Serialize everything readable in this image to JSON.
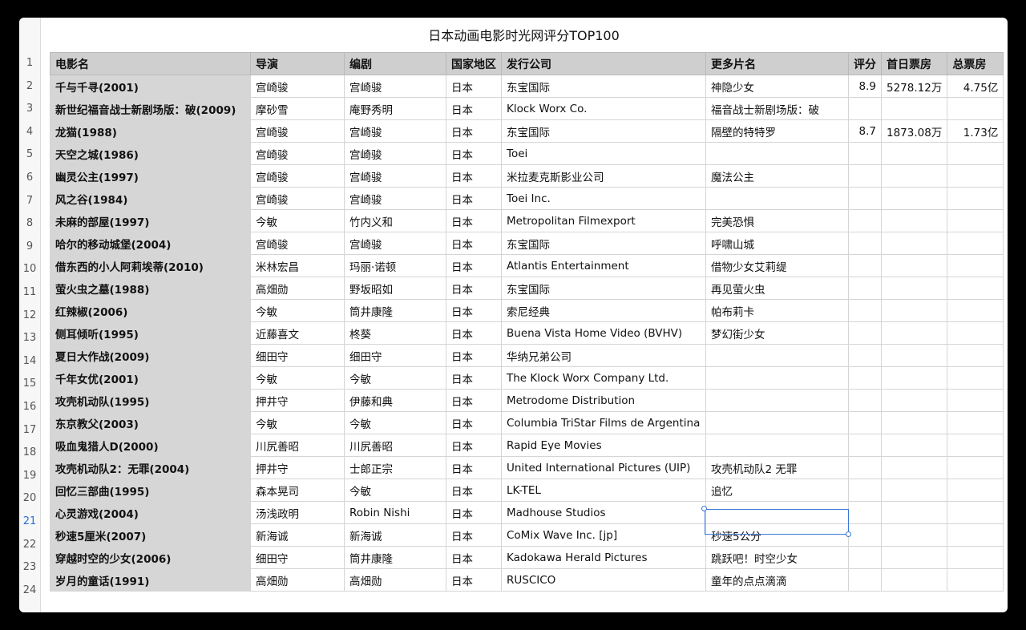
{
  "title": "日本动画电影时光网评分TOP100",
  "headers": [
    "电影名",
    "导演",
    "编剧",
    "国家地区",
    "发行公司",
    "更多片名",
    "评分",
    "首日票房",
    "总票房"
  ],
  "rows": [
    [
      "千与千寻(2001)",
      "宫崎骏",
      "宫崎骏",
      "日本",
      "东宝国际",
      "神隐少女",
      "8.9",
      "5278.12万",
      "4.75亿"
    ],
    [
      "新世纪福音战士新剧场版：破(2009)",
      "摩砂雪",
      "庵野秀明",
      "日本",
      "Klock Worx Co.",
      "福音战士新剧场版：破",
      "",
      "",
      ""
    ],
    [
      "龙猫(1988)",
      "宫崎骏",
      "宫崎骏",
      "日本",
      "东宝国际",
      "隔壁的特特罗",
      "8.7",
      "1873.08万",
      "1.73亿"
    ],
    [
      "天空之城(1986)",
      "宫崎骏",
      "宫崎骏",
      "日本",
      "Toei",
      "",
      "",
      "",
      ""
    ],
    [
      "幽灵公主(1997)",
      "宫崎骏",
      "宫崎骏",
      "日本",
      "米拉麦克斯影业公司",
      "魔法公主",
      "",
      "",
      ""
    ],
    [
      "风之谷(1984)",
      "宫崎骏",
      "宫崎骏",
      "日本",
      "Toei Inc.",
      "",
      "",
      "",
      ""
    ],
    [
      "未麻的部屋(1997)",
      "今敏",
      "竹内义和",
      "日本",
      "Metropolitan Filmexport",
      "完美恐惧",
      "",
      "",
      ""
    ],
    [
      "哈尔的移动城堡(2004)",
      "宫崎骏",
      "宫崎骏",
      "日本",
      "东宝国际",
      "呼啸山城",
      "",
      "",
      ""
    ],
    [
      "借东西的小人阿莉埃蒂(2010)",
      "米林宏昌",
      "玛丽·诺顿",
      "日本",
      "Atlantis Entertainment",
      "借物少女艾莉缇",
      "",
      "",
      ""
    ],
    [
      "萤火虫之墓(1988)",
      "高畑勋",
      "野坂昭如",
      "日本",
      "东宝国际",
      "再见萤火虫",
      "",
      "",
      ""
    ],
    [
      "红辣椒(2006)",
      "今敏",
      "筒井康隆",
      "日本",
      "索尼经典",
      "帕布莉卡",
      "",
      "",
      ""
    ],
    [
      "侧耳倾听(1995)",
      "近藤喜文",
      "柊葵",
      "日本",
      "Buena Vista Home Video (BVHV)",
      "梦幻街少女",
      "",
      "",
      ""
    ],
    [
      "夏日大作战(2009)",
      "细田守",
      "细田守",
      "日本",
      "华纳兄弟公司",
      "",
      "",
      "",
      ""
    ],
    [
      "千年女优(2001)",
      "今敏",
      "今敏",
      "日本",
      "The Klock Worx Company Ltd.",
      "",
      "",
      "",
      ""
    ],
    [
      "攻壳机动队(1995)",
      "押井守",
      "伊藤和典",
      "日本",
      "Metrodome Distribution",
      "",
      "",
      "",
      ""
    ],
    [
      "东京教父(2003)",
      "今敏",
      "今敏",
      "日本",
      "Columbia TriStar Films de Argentina",
      "",
      "",
      "",
      ""
    ],
    [
      "吸血鬼猎人D(2000)",
      "川尻善昭",
      "川尻善昭",
      "日本",
      "Rapid Eye Movies",
      "",
      "",
      "",
      ""
    ],
    [
      "攻壳机动队2：无罪(2004)",
      "押井守",
      "士郎正宗",
      "日本",
      "United International Pictures (UIP)",
      "攻壳机动队2 无罪",
      "",
      "",
      ""
    ],
    [
      "回忆三部曲(1995)",
      "森本晃司",
      "今敏",
      "日本",
      "LK-TEL",
      "追忆",
      "",
      "",
      ""
    ],
    [
      "心灵游戏(2004)",
      "汤浅政明",
      "Robin Nishi",
      "日本",
      "Madhouse Studios",
      "",
      "",
      "",
      ""
    ],
    [
      "秒速5厘米(2007)",
      "新海诚",
      "新海诚",
      "日本",
      "CoMix Wave Inc. [jp]",
      "秒速5公分",
      "",
      "",
      ""
    ],
    [
      "穿越时空的少女(2006)",
      "细田守",
      "筒井康隆",
      "日本",
      "Kadokawa Herald Pictures",
      "跳跃吧！时空少女",
      "",
      "",
      ""
    ],
    [
      "岁月的童话(1991)",
      "高畑勋",
      "高畑勋",
      "日本",
      "RUSCICO",
      "童年的点点滴滴",
      "",
      "",
      ""
    ]
  ],
  "active_row": "21"
}
